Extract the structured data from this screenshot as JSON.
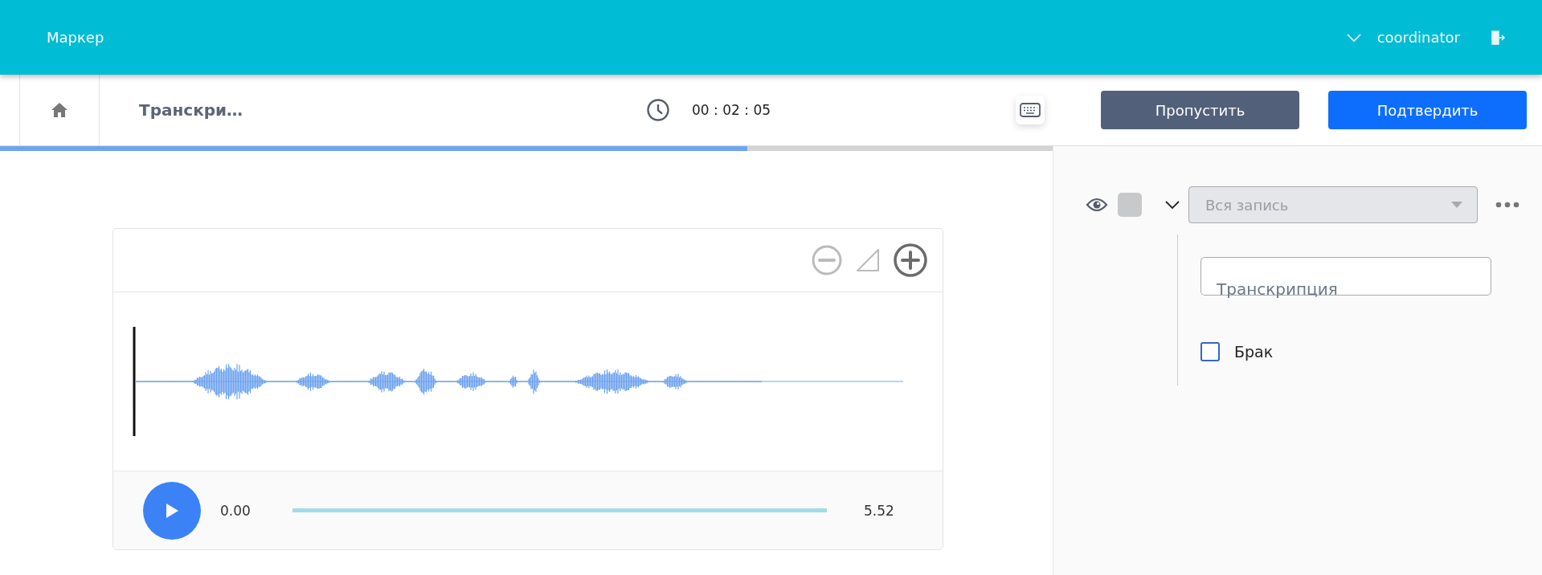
{
  "header": {
    "brand": "Маркер",
    "user": "coordinator"
  },
  "toolbar": {
    "title": "Транскри…",
    "timer": "00 : 02 : 05",
    "progress": {
      "level": 0.71
    },
    "buttons": [
      {
        "label": "Пропустить",
        "kind": "secondary"
      },
      {
        "label": "Подтвердить",
        "kind": "primary"
      }
    ]
  },
  "player": {
    "current": "0.00",
    "duration": "5.52"
  },
  "panel": {
    "segment": {
      "placeholder": "Вся запись",
      "disabled": true
    },
    "transcription": {
      "label": "Транскрипция"
    },
    "defect": {
      "label": "Брак",
      "checked": false
    }
  }
}
